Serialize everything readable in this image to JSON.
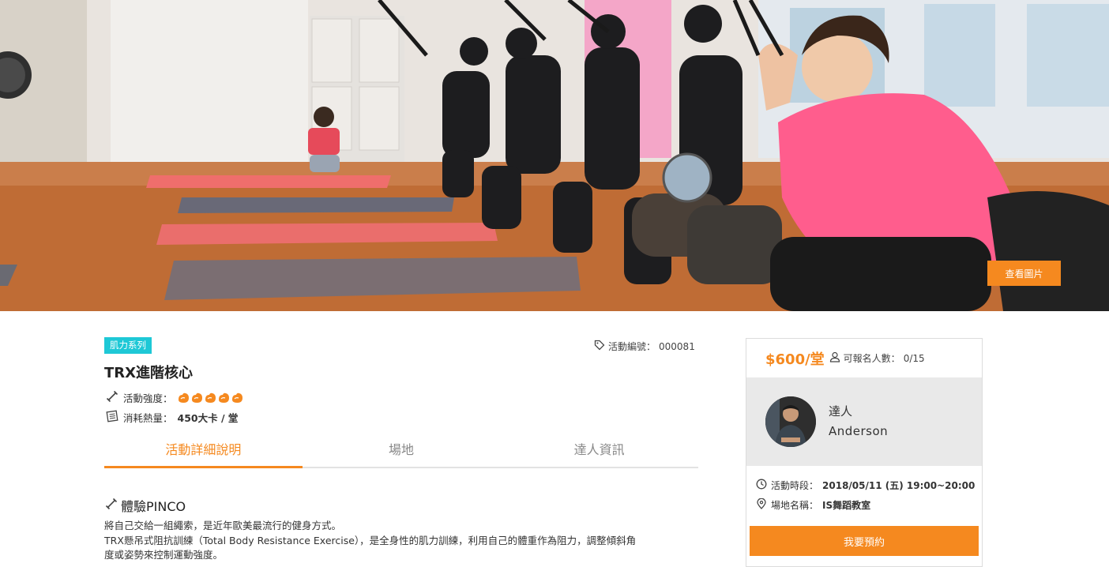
{
  "hero": {
    "view_photos_label": "查看圖片"
  },
  "activity": {
    "category_badge": "肌力系列",
    "number_label": "活動編號：",
    "number_value": "000081",
    "title": "TRX進階核心",
    "intensity_label": "活動強度：",
    "intensity_level": 5,
    "calories_label": "消耗熱量：",
    "calories_value": "450大卡 / 堂"
  },
  "tabs": [
    {
      "label": "活動詳細說明",
      "active": true
    },
    {
      "label": "場地",
      "active": false
    },
    {
      "label": "達人資訊",
      "active": false
    }
  ],
  "section": {
    "title": "體驗PINCO",
    "lines": [
      "將自己交給一組繩索，是近年歐美最流行的健身方式。",
      "TRX懸吊式阻抗訓練（Total Body Resistance Exercise），是全身性的肌力訓練，利用自己的體重作為阻力，調整傾斜角",
      "度或姿勢來控制運動強度。"
    ]
  },
  "booking": {
    "price": "$600/堂",
    "quota_label": "可報名人數：",
    "quota_value": "0/15",
    "coach_role": "達人",
    "coach_name": "Anderson",
    "time_label": "活動時段：",
    "time_value": "2018/05/11 (五) 19:00~20:00",
    "venue_label": "場地名稱：",
    "venue_value": "IS舞蹈教室",
    "book_button": "我要預約"
  },
  "icons": {
    "tag": "tag-icon",
    "intensity": "dumbbell-icon",
    "flame": "flame-icon",
    "calories": "calculator-icon",
    "people": "user-icon",
    "clock": "clock-icon",
    "location": "map-pin-icon"
  },
  "colors": {
    "accent": "#f5891f",
    "badge": "#1ec8d6",
    "coach_bg": "#e9e9e9"
  }
}
